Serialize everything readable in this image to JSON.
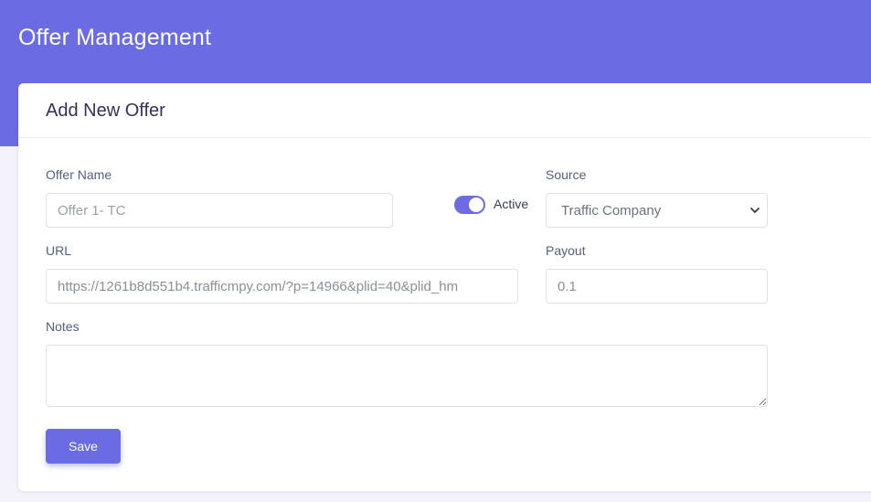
{
  "page": {
    "title": "Offer Management"
  },
  "form": {
    "title": "Add New Offer",
    "offer_name": {
      "label": "Offer Name",
      "placeholder": "Offer 1- TC",
      "value": ""
    },
    "active_toggle": {
      "label": "Active",
      "checked": true
    },
    "source": {
      "label": "Source",
      "selected": "Traffic Company"
    },
    "url": {
      "label": "URL",
      "value": "https://1261b8d551b4.trafficmpy.com/?p=14966&plid=40&plid_hm"
    },
    "payout": {
      "label": "Payout",
      "value": "0.1"
    },
    "notes": {
      "label": "Notes",
      "value": ""
    },
    "save_label": "Save"
  },
  "colors": {
    "accent": "#6b6be4",
    "background": "#f4f3fb",
    "card": "#ffffff"
  },
  "icons": {
    "select_arrow": "chevron-down-icon"
  }
}
